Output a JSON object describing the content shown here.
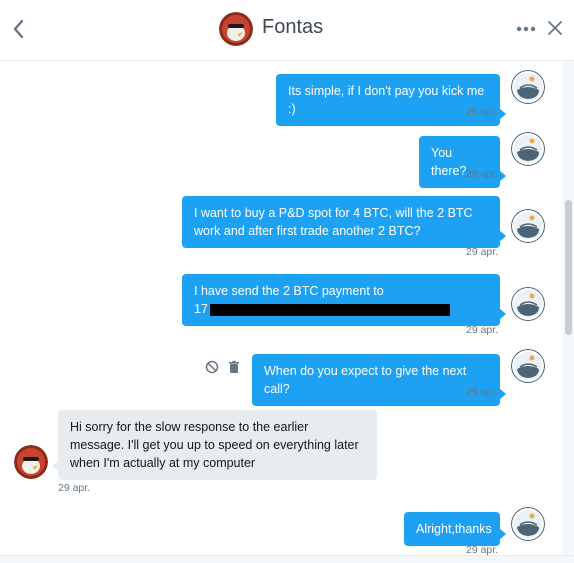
{
  "header": {
    "title": "Fontas",
    "back_icon": "chevron-left-icon",
    "more_icon": "more-icon",
    "close_icon": "close-icon"
  },
  "messages": [
    {
      "direction": "out",
      "text": "Its simple, if I don't pay you kick me :)",
      "timestamp": "26 apr."
    },
    {
      "direction": "out",
      "text": "You there?",
      "timestamp": "28 apr."
    },
    {
      "direction": "out",
      "text": "I want to buy a P&D spot for 4 BTC, will the 2 BTC work and after first trade another 2 BTC?",
      "timestamp": "29 apr."
    },
    {
      "direction": "out",
      "text_line1": "I have send the 2 BTC payment to",
      "text_line2": "17",
      "timestamp": "29 apr.",
      "redacted": true
    },
    {
      "direction": "out",
      "text": "When do you expect to give the next call?",
      "timestamp": "29 apr."
    },
    {
      "direction": "in",
      "text": "Hi sorry for the slow response to the earlier message. I'll get you up to speed on everything later when I'm actually at my computer",
      "timestamp": "29 apr."
    },
    {
      "direction": "out",
      "text": "Alright,thanks",
      "timestamp": "29 apr."
    }
  ],
  "colors": {
    "outgoing_bubble": "#1da1f2",
    "incoming_bubble": "#e6ecf0",
    "timestamp": "#657786"
  }
}
